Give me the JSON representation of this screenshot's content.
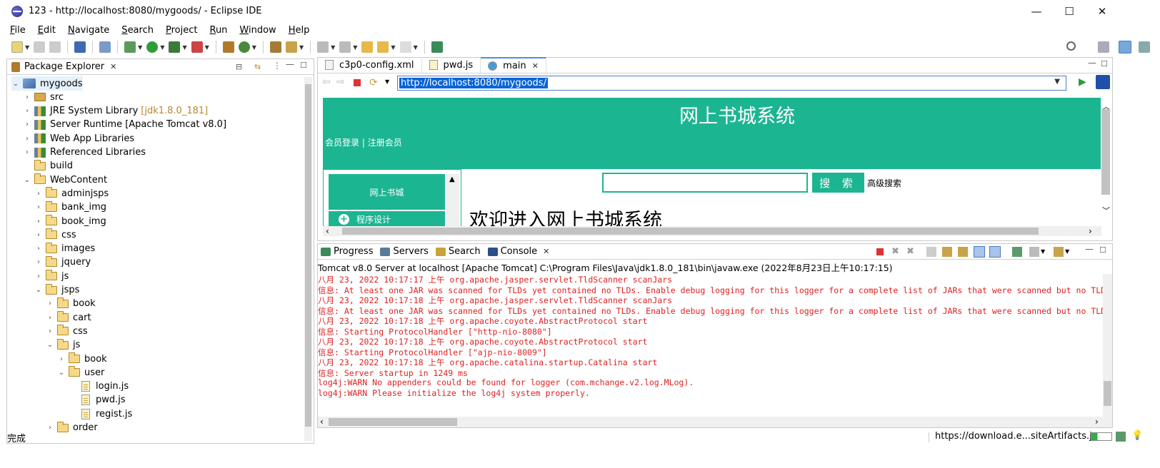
{
  "window": {
    "title": "123 - http://localhost:8080/mygoods/ - Eclipse IDE",
    "minimize": "—",
    "maximize": "☐",
    "close": "✕"
  },
  "menu": [
    "File",
    "Edit",
    "Navigate",
    "Search",
    "Project",
    "Run",
    "Window",
    "Help"
  ],
  "package_explorer": {
    "tab_label": "Package Explorer",
    "tree": [
      {
        "label": "mygoods",
        "level": 0,
        "icon": "project-icon",
        "expanded": true
      },
      {
        "label": "src",
        "level": 1,
        "icon": "source-folder-icon",
        "expanded": false
      },
      {
        "label": "JRE System Library",
        "suffix": "[jdk1.8.0_181]",
        "level": 1,
        "icon": "library-icon",
        "expanded": false
      },
      {
        "label": "Server Runtime [Apache Tomcat v8.0]",
        "level": 1,
        "icon": "library-icon",
        "expanded": false
      },
      {
        "label": "Web App Libraries",
        "level": 1,
        "icon": "library-icon",
        "expanded": false
      },
      {
        "label": "Referenced Libraries",
        "level": 1,
        "icon": "library-icon",
        "expanded": false
      },
      {
        "label": "build",
        "level": 1,
        "icon": "folder-icon",
        "leaf": true
      },
      {
        "label": "WebContent",
        "level": 1,
        "icon": "folder-icon",
        "expanded": true
      },
      {
        "label": "adminjsps",
        "level": 2,
        "icon": "folder-icon",
        "expanded": false
      },
      {
        "label": "bank_img",
        "level": 2,
        "icon": "folder-icon",
        "expanded": false
      },
      {
        "label": "book_img",
        "level": 2,
        "icon": "folder-icon",
        "expanded": false
      },
      {
        "label": "css",
        "level": 2,
        "icon": "folder-icon",
        "expanded": false
      },
      {
        "label": "images",
        "level": 2,
        "icon": "folder-icon",
        "expanded": false
      },
      {
        "label": "jquery",
        "level": 2,
        "icon": "folder-icon",
        "expanded": false
      },
      {
        "label": "js",
        "level": 2,
        "icon": "folder-icon",
        "expanded": false
      },
      {
        "label": "jsps",
        "level": 2,
        "icon": "folder-icon",
        "expanded": true
      },
      {
        "label": "book",
        "level": 3,
        "icon": "folder-icon",
        "expanded": false
      },
      {
        "label": "cart",
        "level": 3,
        "icon": "folder-icon",
        "expanded": false
      },
      {
        "label": "css",
        "level": 3,
        "icon": "folder-icon",
        "expanded": false
      },
      {
        "label": "js",
        "level": 3,
        "icon": "folder-icon",
        "expanded": true
      },
      {
        "label": "book",
        "level": 4,
        "icon": "folder-icon",
        "expanded": false
      },
      {
        "label": "user",
        "level": 4,
        "icon": "folder-icon",
        "expanded": true
      },
      {
        "label": "login.js",
        "level": 5,
        "icon": "js-file-icon",
        "leaf": true
      },
      {
        "label": "pwd.js",
        "level": 5,
        "icon": "js-file-icon",
        "leaf": true
      },
      {
        "label": "regist.js",
        "level": 5,
        "icon": "js-file-icon",
        "leaf": true
      },
      {
        "label": "order",
        "level": 3,
        "icon": "folder-icon",
        "expanded": false
      }
    ]
  },
  "editor": {
    "tabs": [
      {
        "label": "c3p0-config.xml",
        "icon": "xml-file-icon"
      },
      {
        "label": "pwd.js",
        "icon": "js-file-icon"
      },
      {
        "label": "main",
        "icon": "browser-globe-icon",
        "active": true
      }
    ],
    "url": "http://localhost:8080/mygoods/"
  },
  "webpage": {
    "title": "网上书城系统",
    "login_link": "会员登录",
    "divider": "|",
    "register_link": "注册会员",
    "menu_header": "网上书城",
    "menu_item": "程序设计",
    "search_button": "搜 索",
    "advanced_search": "高级搜索",
    "welcome": "欢迎进入网上书城系统",
    "accent_color": "#1cb592"
  },
  "console": {
    "tabs": [
      "Progress",
      "Servers",
      "Search",
      "Console"
    ],
    "header": "Tomcat v8.0 Server at localhost [Apache Tomcat] C:\\Program Files\\Java\\jdk1.8.0_181\\bin\\javaw.exe  (2022年8月23日上午10:17:15)",
    "lines": [
      "八月 23, 2022 10:17:17 上午 org.apache.jasper.servlet.TldScanner scanJars",
      "信息: At least one JAR was scanned for TLDs yet contained no TLDs. Enable debug logging for this logger for a complete list of JARs that were scanned but no TLDs we",
      "八月 23, 2022 10:17:18 上午 org.apache.jasper.servlet.TldScanner scanJars",
      "信息: At least one JAR was scanned for TLDs yet contained no TLDs. Enable debug logging for this logger for a complete list of JARs that were scanned but no TLDs we",
      "八月 23, 2022 10:17:18 上午 org.apache.coyote.AbstractProtocol start",
      "信息: Starting ProtocolHandler [\"http-nio-8080\"]",
      "八月 23, 2022 10:17:18 上午 org.apache.coyote.AbstractProtocol start",
      "信息: Starting ProtocolHandler [\"ajp-nio-8009\"]",
      "八月 23, 2022 10:17:18 上午 org.apache.catalina.startup.Catalina start",
      "信息: Server startup in 1249 ms",
      "log4j:WARN No appenders could be found for logger (com.mchange.v2.log.MLog).",
      "log4j:WARN Please initialize the log4j system properly."
    ],
    "text_color": "#dd2222"
  },
  "status": {
    "left": "完成",
    "right": "https://download.e...siteArtifacts.jar"
  }
}
